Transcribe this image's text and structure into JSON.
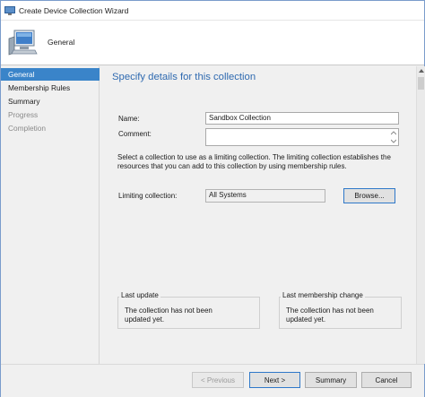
{
  "window": {
    "title": "Create Device Collection Wizard"
  },
  "header": {
    "title": "General",
    "icon": "computer-icon"
  },
  "nav": {
    "items": [
      {
        "label": "General",
        "state": "active"
      },
      {
        "label": "Membership Rules",
        "state": "enabled"
      },
      {
        "label": "Summary",
        "state": "enabled"
      },
      {
        "label": "Progress",
        "state": "disabled"
      },
      {
        "label": "Completion",
        "state": "disabled"
      }
    ]
  },
  "main": {
    "section_title": "Specify details for this collection",
    "name_label": "Name:",
    "name_value": "Sandbox Collection",
    "comment_label": "Comment:",
    "comment_value": "",
    "description": "Select a collection to use as a limiting collection. The limiting collection establishes the resources that you can add to this collection by using membership rules.",
    "limiting_label": "Limiting collection:",
    "limiting_value": "All Systems",
    "browse_label": "Browse...",
    "last_update": {
      "legend": "Last update",
      "text": "The collection has not been updated yet."
    },
    "last_membership": {
      "legend": "Last membership change",
      "text": "The collection has not been updated yet."
    }
  },
  "footer": {
    "previous_label": "< Previous",
    "next_label": "Next >",
    "summary_label": "Summary",
    "cancel_label": "Cancel"
  },
  "colors": {
    "accent": "#3a84c9",
    "section_title": "#2f6ab0"
  }
}
